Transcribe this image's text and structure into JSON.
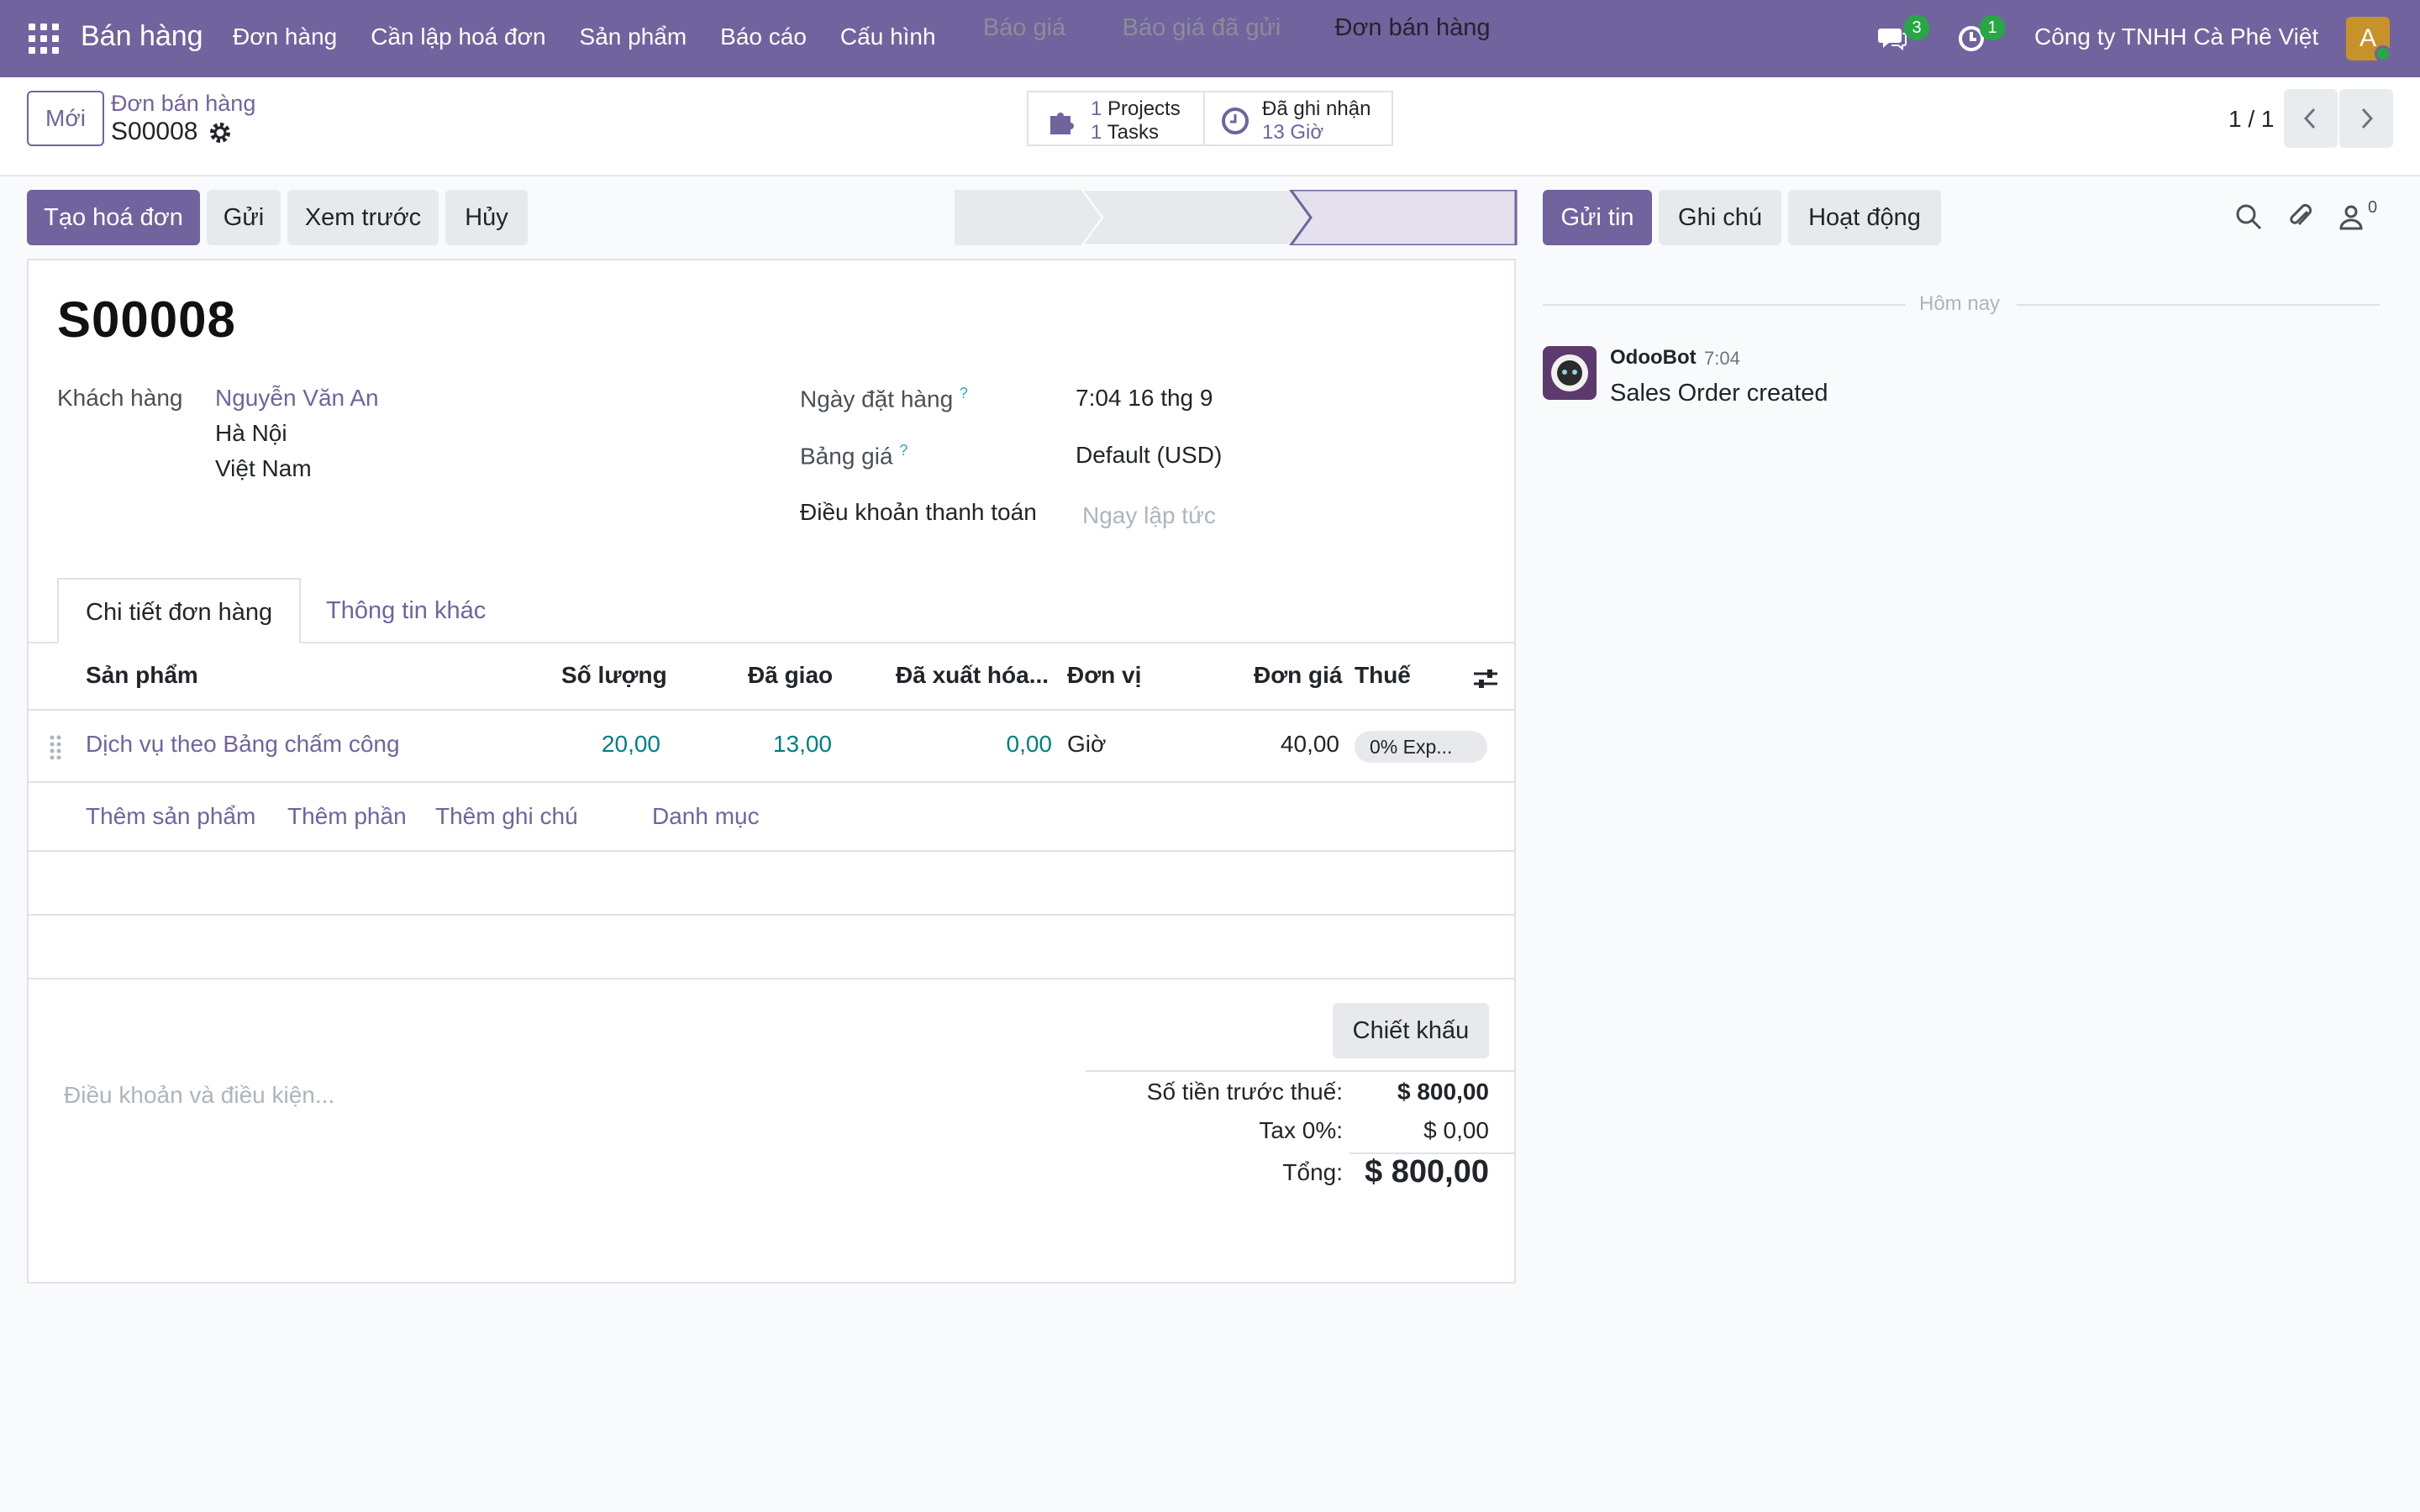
{
  "nav": {
    "app_name": "Bán hàng",
    "menu": [
      "Đơn hàng",
      "Cần lập hoá đơn",
      "Sản phẩm",
      "Báo cáo",
      "Cấu hình"
    ],
    "messages_count": "3",
    "activities_count": "1",
    "company": "Công ty TNHH Cà Phê Việt",
    "avatar_letter": "A"
  },
  "control": {
    "new_label": "Mới",
    "breadcrumb_parent": "Đơn bán hàng",
    "breadcrumb_current": "S00008",
    "smart_projects_count": "1",
    "smart_projects_label": "Projects",
    "smart_tasks_count": "1",
    "smart_tasks_label": "Tasks",
    "smart_recorded_label": "Đã ghi nhận",
    "smart_recorded_value": "13 Giờ",
    "pager": "1 / 1"
  },
  "actions": {
    "create_invoice": "Tạo hoá đơn",
    "send": "Gửi",
    "preview": "Xem trước",
    "cancel": "Hủy"
  },
  "stages": [
    "Báo giá",
    "Báo giá đã gửi",
    "Đơn bán hàng"
  ],
  "active_stage_index": 2,
  "form": {
    "order_name": "S00008",
    "customer_label": "Khách hàng",
    "customer_name": "Nguyễn Văn An",
    "customer_city": "Hà Nội",
    "customer_country": "Việt Nam",
    "order_date_label": "Ngày đặt hàng",
    "order_date_value": "7:04 16 thg 9",
    "pricelist_label": "Bảng giá",
    "pricelist_value": "Default (USD)",
    "payment_terms_label": "Điều khoản thanh toán",
    "payment_terms_placeholder": "Ngay lập tức",
    "help_mark": "?"
  },
  "tabs": [
    "Chi tiết đơn hàng",
    "Thông tin khác"
  ],
  "lines": {
    "headers": {
      "product": "Sản phẩm",
      "quantity": "Số lượng",
      "delivered": "Đã giao",
      "invoiced": "Đã xuất hóa...",
      "uom": "Đơn vị",
      "unit_price": "Đơn giá",
      "taxes": "Thuế"
    },
    "rows": [
      {
        "product": "Dịch vụ theo Bảng chấm công",
        "quantity": "20,00",
        "delivered": "13,00",
        "invoiced": "0,00",
        "uom": "Giờ",
        "unit_price": "40,00",
        "taxes": "0% Exp..."
      }
    ],
    "add_product": "Thêm sản phẩm",
    "add_section": "Thêm phần",
    "add_note": "Thêm ghi chú",
    "catalog": "Danh mục"
  },
  "totals": {
    "discount_button": "Chiết khấu",
    "terms_placeholder": "Điều khoản và điều kiện...",
    "untaxed_label": "Số tiền trước thuế:",
    "untaxed_value": "$ 800,00",
    "tax_label": "Tax 0%:",
    "tax_value": "$ 0,00",
    "total_label": "Tổng:",
    "total_value": "$ 800,00"
  },
  "chatter": {
    "send_message": "Gửi tin",
    "log_note": "Ghi chú",
    "activities": "Hoạt động",
    "followers_count": "0",
    "date_separator": "Hôm nay",
    "message_author": "OdooBot",
    "message_time": "7:04",
    "message_body": "Sales Order created"
  },
  "colors": {
    "brand": "#71639e",
    "badge": "#28a745",
    "link_teal": "#017e84"
  }
}
